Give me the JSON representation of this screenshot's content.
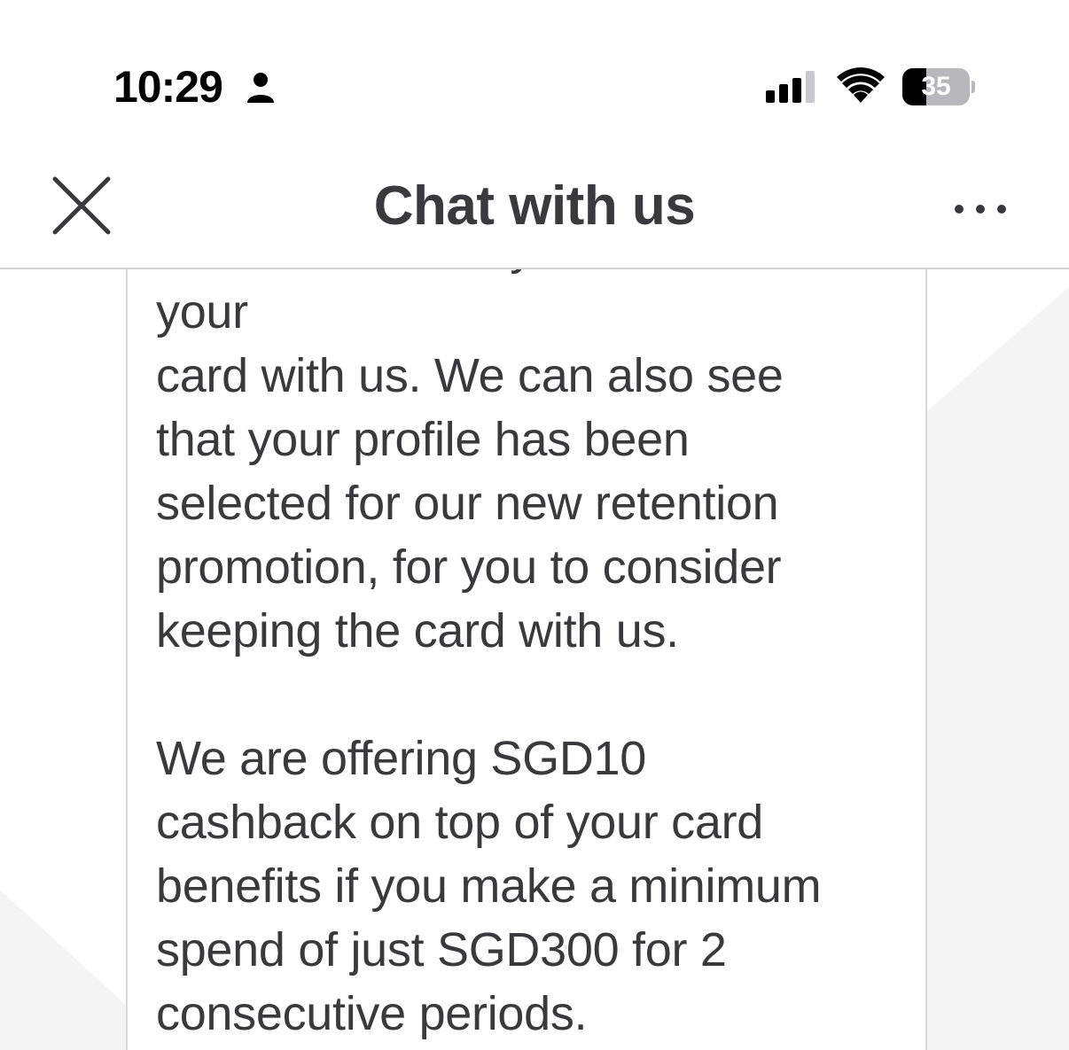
{
  "status_bar": {
    "time": "10:29",
    "battery_percent": "35",
    "battery_level": 0.35,
    "icons": [
      "person-icon",
      "cellular-signal-icon",
      "wifi-icon",
      "battery-icon"
    ]
  },
  "header": {
    "title": "Chat with us",
    "close_icon": "close-icon",
    "more_icon": "more-horizontal-icon"
  },
  "message": {
    "partial_line": "We can see that you want to cancel your",
    "paragraph_1_lines": [
      "card with us. We can also see",
      "that your profile has been",
      "selected for our new retention",
      "promotion, for you to consider",
      "keeping the card with us."
    ],
    "paragraph_2_lines": [
      "We are offering SGD10",
      "cashback on top of your card",
      "benefits if you make a minimum",
      "spend of just SGD300 for 2",
      "consecutive periods."
    ]
  },
  "colors": {
    "text": "#3a3a3c",
    "divider": "#d4d4d6",
    "background": "#ffffff",
    "bubble_border": "#d8d8da"
  }
}
